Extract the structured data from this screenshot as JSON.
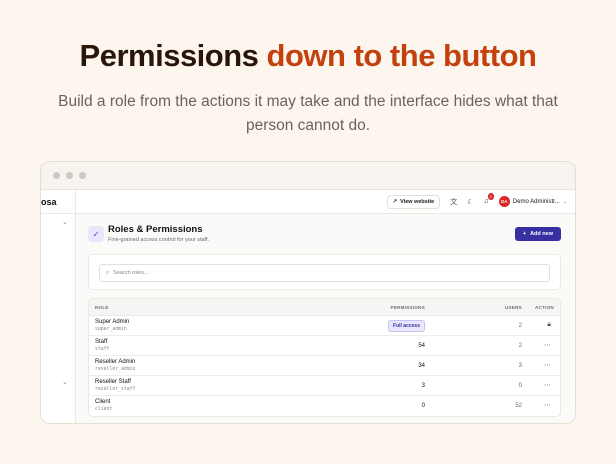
{
  "hero": {
    "title_main": "Permissions ",
    "title_accent": "down to the button",
    "subtitle": "Build a role from the actions it may take and the interface hides what that person cannot do."
  },
  "sidebar": {
    "brand": "osa"
  },
  "topbar": {
    "view_website": "View website",
    "notification_count": "2",
    "user_initials": "DA",
    "user_name": "Demo Administr..."
  },
  "page": {
    "title": "Roles & Permissions",
    "description": "Fine-grained access control for your staff.",
    "add_button": "Add new",
    "search_placeholder": "Search roles..."
  },
  "table": {
    "columns": {
      "role": "ROLE",
      "permissions": "PERMISSIONS",
      "users": "USERS",
      "action": "ACTION"
    },
    "rows": [
      {
        "name": "Super Admin",
        "slug": "super_admin",
        "permissions": "Full access",
        "users": "2",
        "action": "lock-icon"
      },
      {
        "name": "Staff",
        "slug": "staff",
        "permissions": "54",
        "users": "2",
        "action": "more-icon"
      },
      {
        "name": "Reseller Admin",
        "slug": "reseller_admin",
        "permissions": "34",
        "users": "3",
        "action": "more-icon"
      },
      {
        "name": "Reseller Staff",
        "slug": "reseller_staff",
        "permissions": "3",
        "users": "0",
        "action": "more-icon"
      },
      {
        "name": "Client",
        "slug": "client",
        "permissions": "0",
        "users": "52",
        "action": "more-icon"
      }
    ]
  },
  "colors": {
    "accent": "#c2410c",
    "primary": "#3730a3",
    "background": "#fdf6ef"
  }
}
